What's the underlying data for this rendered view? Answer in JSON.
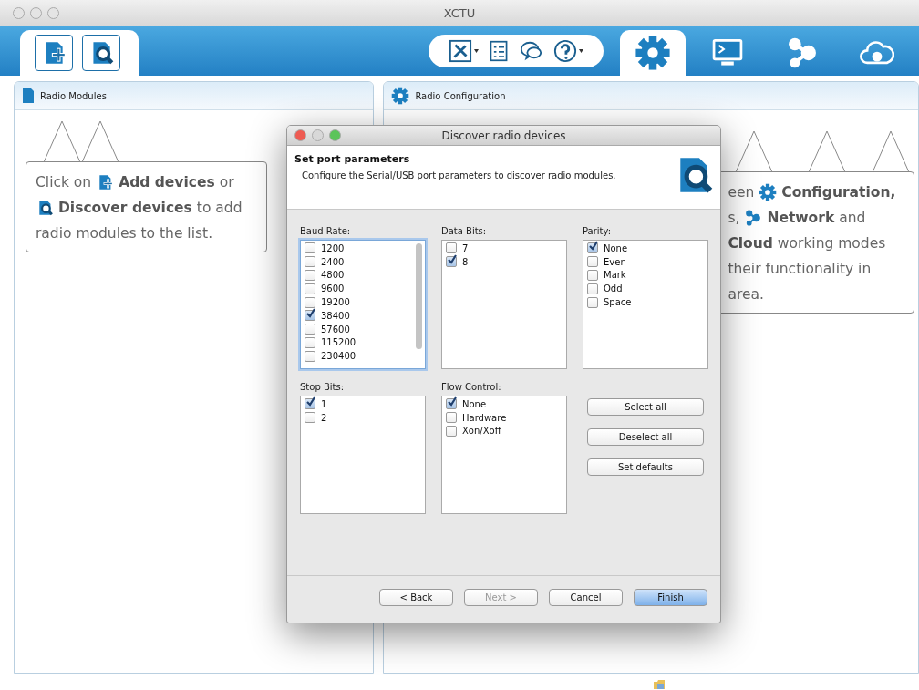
{
  "window": {
    "title": "XCTU"
  },
  "toolbar": {
    "left_buttons": [
      {
        "kind": "add"
      },
      {
        "kind": "discover"
      }
    ],
    "tools": [
      {
        "kind": "tools",
        "dropdown": true
      },
      {
        "kind": "list",
        "dropdown": false
      },
      {
        "kind": "chat",
        "dropdown": false
      },
      {
        "kind": "help",
        "dropdown": true
      }
    ],
    "modes": [
      {
        "kind": "gear",
        "selected": true
      },
      {
        "kind": "terminal",
        "selected": false
      },
      {
        "kind": "network",
        "selected": false
      },
      {
        "kind": "cloud",
        "selected": false
      }
    ]
  },
  "left_panel": {
    "title": "Radio Modules",
    "callout": [
      [
        {
          "kind": "text",
          "text": "Click on"
        },
        {
          "kind": "add-icon"
        },
        {
          "kind": "bold",
          "text": "Add devices"
        },
        {
          "kind": "text",
          "text": "or"
        }
      ],
      [
        {
          "kind": "discover-icon"
        },
        {
          "kind": "bold",
          "text": "Discover devices"
        },
        {
          "kind": "text",
          "text": "to add"
        }
      ],
      [
        {
          "kind": "text",
          "text": "radio modules to the list."
        }
      ]
    ]
  },
  "right_panel": {
    "title": "Radio Configuration",
    "callout": [
      [
        {
          "kind": "text",
          "text": "een"
        },
        {
          "kind": "gear-icon"
        },
        {
          "kind": "bold",
          "text": "Configuration,"
        }
      ],
      [
        {
          "kind": "text",
          "text": "s,"
        },
        {
          "kind": "network-icon"
        },
        {
          "kind": "bold",
          "text": "Network"
        },
        {
          "kind": "text",
          "text": "and"
        }
      ],
      [
        {
          "kind": "bold",
          "text": "Cloud"
        },
        {
          "kind": "text",
          "text": "working modes"
        }
      ],
      [
        {
          "kind": "text",
          "text": "their"
        },
        {
          "kind": "text",
          "text": "functionality in"
        }
      ],
      [
        {
          "kind": "text",
          "text": "area."
        }
      ]
    ]
  },
  "dialog": {
    "title": "Discover radio devices",
    "heading": "Set port parameters",
    "subtitle": "Configure the Serial/USB port parameters to discover radio modules.",
    "groups": [
      {
        "label": "Baud Rate:",
        "focused": true,
        "scrollbar": true,
        "items": [
          {
            "label": "1200",
            "checked": false
          },
          {
            "label": "2400",
            "checked": false
          },
          {
            "label": "4800",
            "checked": false
          },
          {
            "label": "9600",
            "checked": false
          },
          {
            "label": "19200",
            "checked": false
          },
          {
            "label": "38400",
            "checked": true
          },
          {
            "label": "57600",
            "checked": false
          },
          {
            "label": "115200",
            "checked": false
          },
          {
            "label": "230400",
            "checked": false
          }
        ]
      },
      {
        "label": "Data Bits:",
        "focused": false,
        "scrollbar": false,
        "items": [
          {
            "label": "7",
            "checked": false
          },
          {
            "label": "8",
            "checked": true
          }
        ]
      },
      {
        "label": "Parity:",
        "focused": false,
        "scrollbar": false,
        "items": [
          {
            "label": "None",
            "checked": true
          },
          {
            "label": "Even",
            "checked": false
          },
          {
            "label": "Mark",
            "checked": false
          },
          {
            "label": "Odd",
            "checked": false
          },
          {
            "label": "Space",
            "checked": false
          }
        ]
      },
      {
        "label": "Stop Bits:",
        "focused": false,
        "scrollbar": false,
        "items": [
          {
            "label": "1",
            "checked": true
          },
          {
            "label": "2",
            "checked": false
          }
        ]
      },
      {
        "label": "Flow Control:",
        "focused": false,
        "scrollbar": false,
        "items": [
          {
            "label": "None",
            "checked": true
          },
          {
            "label": "Hardware",
            "checked": false
          },
          {
            "label": "Xon/Xoff",
            "checked": false
          }
        ]
      }
    ],
    "side_buttons": [
      "Select all",
      "Deselect all",
      "Set defaults"
    ],
    "footer_buttons": [
      {
        "label": "< Back",
        "disabled": false,
        "default": false
      },
      {
        "label": "Next >",
        "disabled": true,
        "default": false
      },
      {
        "label": "Cancel",
        "disabled": false,
        "default": false
      },
      {
        "label": "Finish",
        "disabled": false,
        "default": true
      }
    ]
  }
}
